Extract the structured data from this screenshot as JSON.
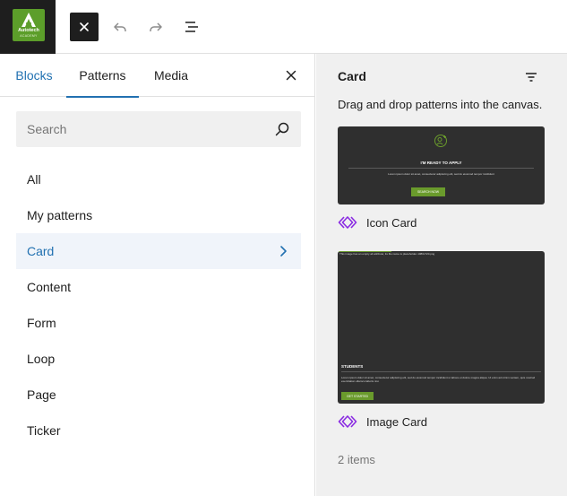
{
  "topbar": {
    "logo": {
      "line1": "Autotech",
      "line2": "ACADEMY",
      "brand_color": "#5c9e2a"
    },
    "icons": [
      "close-icon",
      "undo-icon",
      "redo-icon",
      "list-view-icon"
    ]
  },
  "inserter": {
    "tabs": [
      {
        "label": "Blocks"
      },
      {
        "label": "Patterns"
      },
      {
        "label": "Media"
      }
    ],
    "search": {
      "placeholder": "Search",
      "value": ""
    },
    "categories": [
      {
        "label": "All"
      },
      {
        "label": "My patterns"
      },
      {
        "label": "Card"
      },
      {
        "label": "Content"
      },
      {
        "label": "Form"
      },
      {
        "label": "Loop"
      },
      {
        "label": "Page"
      },
      {
        "label": "Ticker"
      }
    ],
    "accent_color": "#2271b1"
  },
  "patterns_panel": {
    "title": "Card",
    "hint": "Drag and drop patterns into the canvas.",
    "patterns": [
      {
        "name": "Icon Card",
        "preview": {
          "heading": "I'M READY TO APPLY",
          "body": "Lorem ipsum dolor sit amet, consectetur adipiscing elit, sed do eiusmod tempor incididunt",
          "button": "SEARCH NOW"
        }
      },
      {
        "name": "Image Card",
        "preview": {
          "caption": "This image has an empty alt attribute; its file name is placeholder-1080x720.png",
          "heading": "STUDENTS",
          "body": "Lorem ipsum dolor sit amet, consectetur adipiscing elit, sed do eiusmod tempor incididunt ut labore et dolore magna aliqua. Ut enim ad minim veniam, quis nostrud exercitation ullamco laboris nisi.",
          "button": "GET STARTED"
        }
      }
    ],
    "count": "2 items",
    "pattern_icon_color": "#8a2be2"
  }
}
